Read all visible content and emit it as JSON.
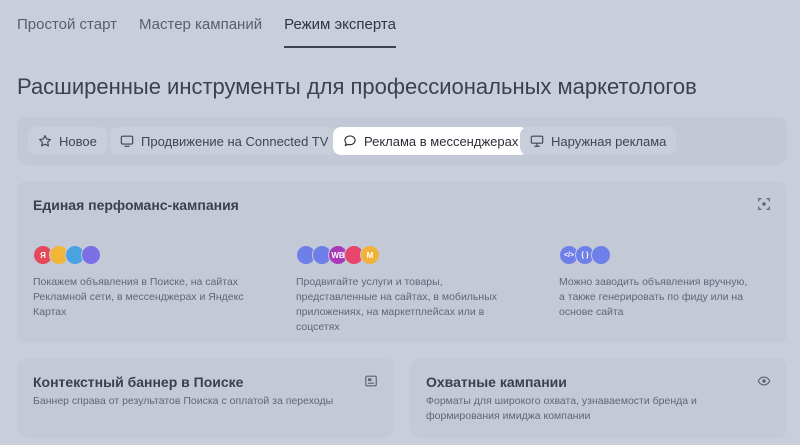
{
  "tabs": [
    {
      "label": "Простой старт"
    },
    {
      "label": "Мастер кампаний"
    },
    {
      "label": "Режим эксперта"
    }
  ],
  "page_title": "Расширенные инструменты для профессиональных маркетологов",
  "chips": [
    {
      "label": "Новое",
      "icon": "star-icon"
    },
    {
      "label": "Продвижение на Connected TV",
      "icon": "tv-icon"
    },
    {
      "label": "Реклама в мессенджерах",
      "icon": "chat-icon"
    },
    {
      "label": "Наружная реклама",
      "icon": "billboard-icon"
    }
  ],
  "perf_card": {
    "title": "Единая перфоманс-кампания",
    "features": [
      {
        "text": "Покажем объявления в Поиске, на сайтах Рекламной сети, в мессенджерах и Яндекс Картах",
        "badges": [
          "Я",
          "",
          "",
          ""
        ]
      },
      {
        "text": "Продвигайте услуги и товары, представленные на сайтах, в мобильных приложениях, на маркетплейсах или в соцсетях",
        "badges": [
          "",
          "",
          "WB",
          "",
          "M"
        ]
      },
      {
        "text": "Можно заводить объявления вручную, а также генерировать по фиду или на основе сайта",
        "badges": [
          "</>",
          "{ }",
          ""
        ]
      }
    ]
  },
  "banner_card": {
    "title": "Контекстный баннер в Поиске",
    "desc": "Баннер справа от результатов Поиска с оплатой за переходы"
  },
  "reach_card": {
    "title": "Охватные кампании",
    "desc": "Форматы для широкого охвата, узнаваемости бренда и формирования имиджа компании"
  },
  "colors": {
    "accent": "#3b4250",
    "background": "#c9ceda",
    "card": "#c3c9d6"
  }
}
